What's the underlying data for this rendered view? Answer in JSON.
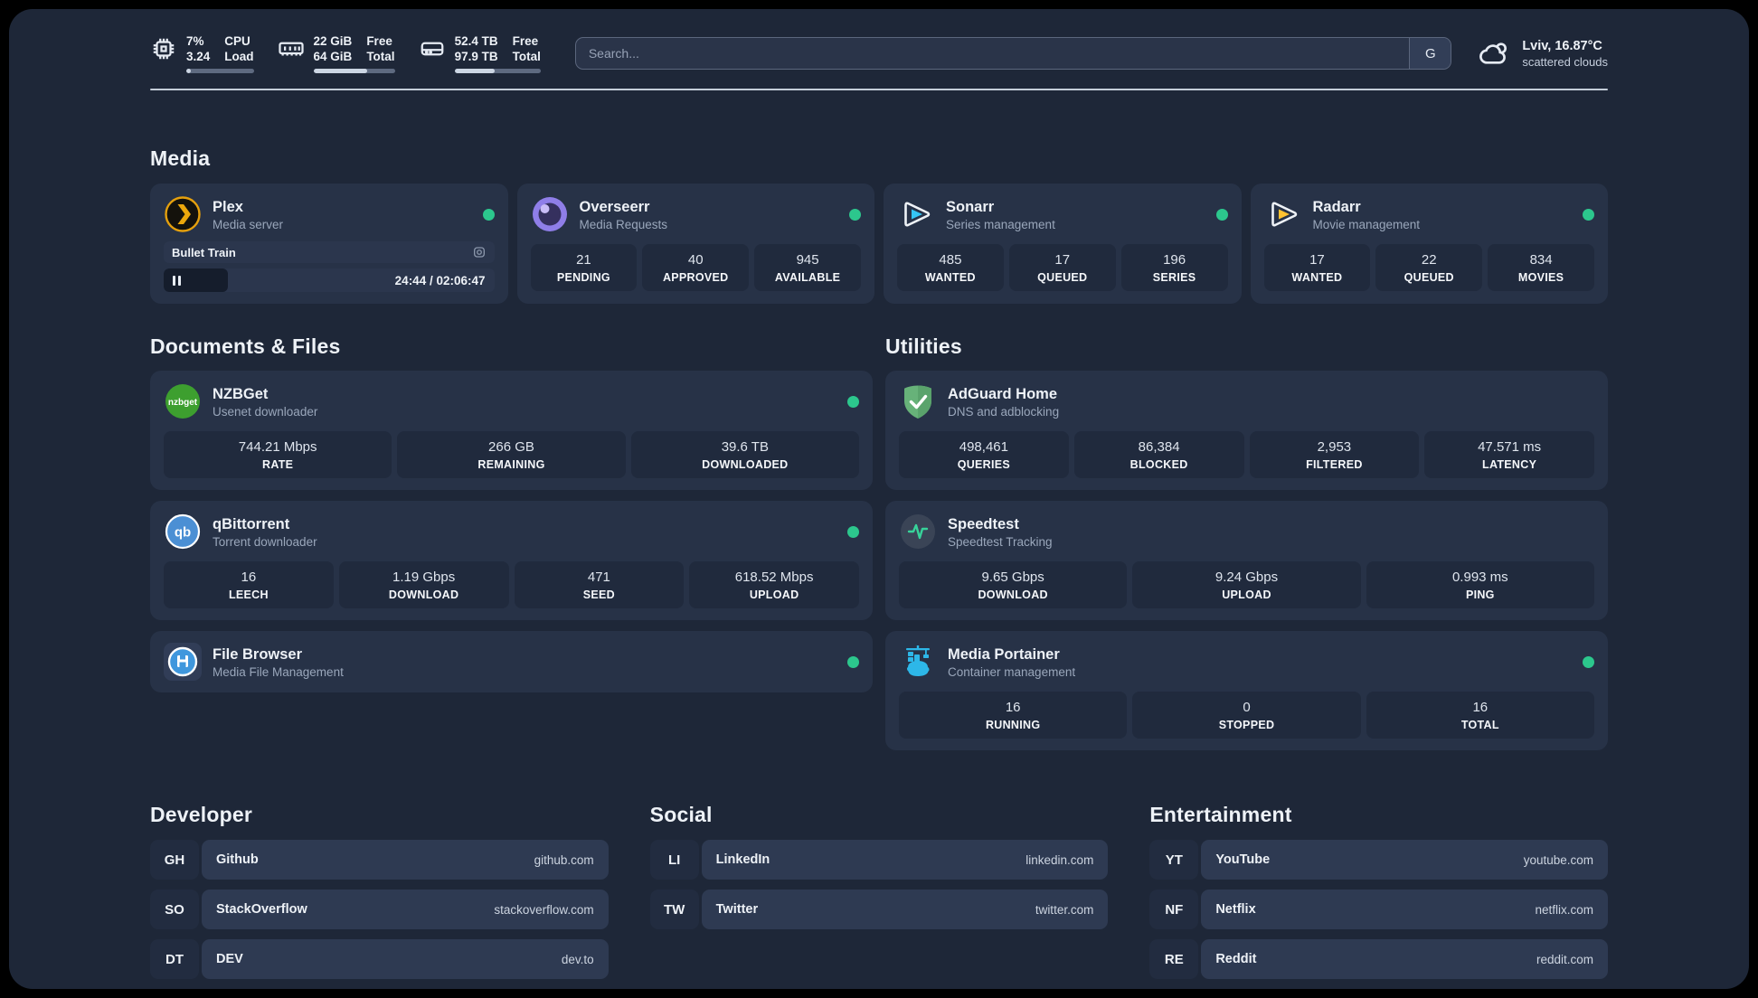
{
  "header": {
    "stats": [
      {
        "icon": "cpu-icon",
        "value1": "7%",
        "value2": "3.24",
        "label1": "CPU",
        "label2": "Load",
        "progress": 7
      },
      {
        "icon": "memory-icon",
        "value1": "22 GiB",
        "value2": "64 GiB",
        "label1": "Free",
        "label2": "Total",
        "progress": 66
      },
      {
        "icon": "disk-icon",
        "value1": "52.4 TB",
        "value2": "97.9 TB",
        "label1": "Free",
        "label2": "Total",
        "progress": 47
      }
    ],
    "search": {
      "placeholder": "Search...",
      "button_label": "G"
    },
    "weather": {
      "location_temp": "Lviv, 16.87°C",
      "condition": "scattered clouds"
    }
  },
  "media": {
    "title": "Media",
    "plex": {
      "name": "Plex",
      "description": "Media server",
      "online": true,
      "now_playing": "Bullet Train",
      "time": "24:44 / 02:06:47",
      "progress": 19.5,
      "state": "paused"
    },
    "overseerr": {
      "name": "Overseerr",
      "description": "Media Requests",
      "online": true,
      "stats": [
        {
          "value": "21",
          "label": "PENDING"
        },
        {
          "value": "40",
          "label": "APPROVED"
        },
        {
          "value": "945",
          "label": "AVAILABLE"
        }
      ]
    },
    "sonarr": {
      "name": "Sonarr",
      "description": "Series management",
      "online": true,
      "stats": [
        {
          "value": "485",
          "label": "WANTED"
        },
        {
          "value": "17",
          "label": "QUEUED"
        },
        {
          "value": "196",
          "label": "SERIES"
        }
      ]
    },
    "radarr": {
      "name": "Radarr",
      "description": "Movie management",
      "online": true,
      "stats": [
        {
          "value": "17",
          "label": "WANTED"
        },
        {
          "value": "22",
          "label": "QUEUED"
        },
        {
          "value": "834",
          "label": "MOVIES"
        }
      ]
    }
  },
  "documents": {
    "title": "Documents & Files",
    "nzbget": {
      "name": "NZBGet",
      "description": "Usenet downloader",
      "online": true,
      "stats": [
        {
          "value": "744.21 Mbps",
          "label": "RATE"
        },
        {
          "value": "266 GB",
          "label": "REMAINING"
        },
        {
          "value": "39.6 TB",
          "label": "DOWNLOADED"
        }
      ]
    },
    "qbittorrent": {
      "name": "qBittorrent",
      "description": "Torrent downloader",
      "online": true,
      "stats": [
        {
          "value": "16",
          "label": "LEECH"
        },
        {
          "value": "1.19 Gbps",
          "label": "DOWNLOAD"
        },
        {
          "value": "471",
          "label": "SEED"
        },
        {
          "value": "618.52 Mbps",
          "label": "UPLOAD"
        }
      ]
    },
    "filebrowser": {
      "name": "File Browser",
      "description": "Media File Management",
      "online": true
    }
  },
  "utilities": {
    "title": "Utilities",
    "adguard": {
      "name": "AdGuard Home",
      "description": "DNS and adblocking",
      "stats": [
        {
          "value": "498,461",
          "label": "QUERIES"
        },
        {
          "value": "86,384",
          "label": "BLOCKED"
        },
        {
          "value": "2,953",
          "label": "FILTERED"
        },
        {
          "value": "47.571 ms",
          "label": "LATENCY"
        }
      ]
    },
    "speedtest": {
      "name": "Speedtest",
      "description": "Speedtest Tracking",
      "stats": [
        {
          "value": "9.65 Gbps",
          "label": "DOWNLOAD"
        },
        {
          "value": "9.24 Gbps",
          "label": "UPLOAD"
        },
        {
          "value": "0.993 ms",
          "label": "PING"
        }
      ]
    },
    "portainer": {
      "name": "Media Portainer",
      "description": "Container management",
      "online": true,
      "stats": [
        {
          "value": "16",
          "label": "RUNNING"
        },
        {
          "value": "0",
          "label": "STOPPED"
        },
        {
          "value": "16",
          "label": "TOTAL"
        }
      ]
    }
  },
  "links": {
    "developer": {
      "title": "Developer",
      "items": [
        {
          "abbr": "GH",
          "name": "Github",
          "url": "github.com"
        },
        {
          "abbr": "SO",
          "name": "StackOverflow",
          "url": "stackoverflow.com"
        },
        {
          "abbr": "DT",
          "name": "DEV",
          "url": "dev.to"
        }
      ]
    },
    "social": {
      "title": "Social",
      "items": [
        {
          "abbr": "LI",
          "name": "LinkedIn",
          "url": "linkedin.com"
        },
        {
          "abbr": "TW",
          "name": "Twitter",
          "url": "twitter.com"
        }
      ]
    },
    "entertainment": {
      "title": "Entertainment",
      "items": [
        {
          "abbr": "YT",
          "name": "YouTube",
          "url": "youtube.com"
        },
        {
          "abbr": "NF",
          "name": "Netflix",
          "url": "netflix.com"
        },
        {
          "abbr": "RE",
          "name": "Reddit",
          "url": "reddit.com"
        }
      ]
    }
  },
  "colors": {
    "status_online": "#2cc78d",
    "plex": "#e5a00d",
    "sonarr": "#35c5f4",
    "radarr": "#ffc230",
    "nzbget": "#3d9f2f",
    "qbittorrent": "#4b8fd4",
    "adguard": "#67b279",
    "speedtest": "#37d39a",
    "portainer": "#2db7e8",
    "filebrowser": "#3f97dd"
  }
}
